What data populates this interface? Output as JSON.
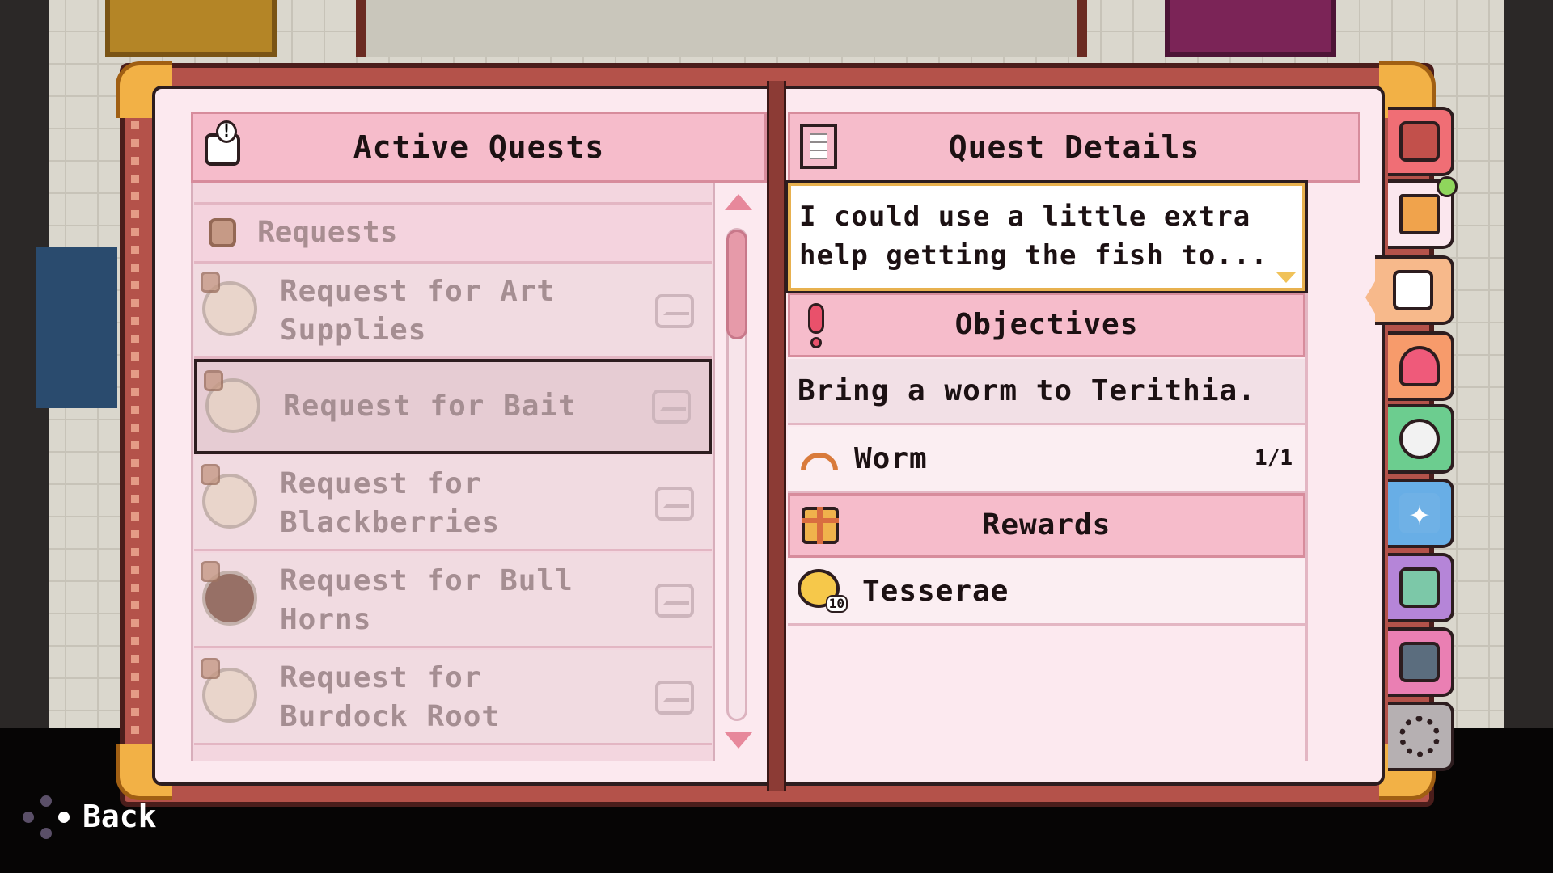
{
  "quest_log": {
    "title": "Active Quests",
    "category": "Requests",
    "quests": [
      {
        "label": "Request for Art Supplies",
        "line1": "Request for Art",
        "line2": "Supplies",
        "selected": false
      },
      {
        "label": "Request for Bait",
        "line1": "Request for Bait",
        "line2": "",
        "selected": true
      },
      {
        "label": "Request for Blackberries",
        "line1": "Request for",
        "line2": "Blackberries",
        "selected": false
      },
      {
        "label": "Request for Bull Horns",
        "line1": "Request for Bull",
        "line2": "Horns",
        "selected": false
      },
      {
        "label": "Request for Burdock Root",
        "line1": "Request for",
        "line2": "Burdock Root",
        "selected": false
      }
    ]
  },
  "details": {
    "title": "Quest Details",
    "description_line1": "I could use a little extra",
    "description_line2": "help getting the fish to...",
    "objectives_title": "Objectives",
    "objective_text": "Bring a worm to Terithia.",
    "required_item": {
      "name": "Worm",
      "quantity": "1/1"
    },
    "rewards_title": "Rewards",
    "reward": {
      "name": "Tesserae",
      "amount": "10"
    }
  },
  "side_tabs": [
    {
      "name": "inventory",
      "icon": "backpack-icon",
      "color": "#f06e75"
    },
    {
      "name": "wardrobe",
      "icon": "shirt-icon",
      "color": "#fbe7ee",
      "badge": true
    },
    {
      "name": "quests",
      "icon": "envelope-icon",
      "color": "#f7b98b",
      "active": true
    },
    {
      "name": "relationships",
      "icon": "heart-icon",
      "color": "#f79b6b"
    },
    {
      "name": "animals",
      "icon": "cow-icon",
      "color": "#6ccd8f"
    },
    {
      "name": "skills",
      "icon": "sparkle-icon",
      "color": "#68aee6"
    },
    {
      "name": "map",
      "icon": "map-icon",
      "color": "#b585d8"
    },
    {
      "name": "messages",
      "icon": "chat-icon",
      "color": "#ea7fb3"
    },
    {
      "name": "settings",
      "icon": "gear-icon",
      "color": "#b6b0b2"
    }
  ],
  "footer": {
    "back_label": "Back"
  }
}
